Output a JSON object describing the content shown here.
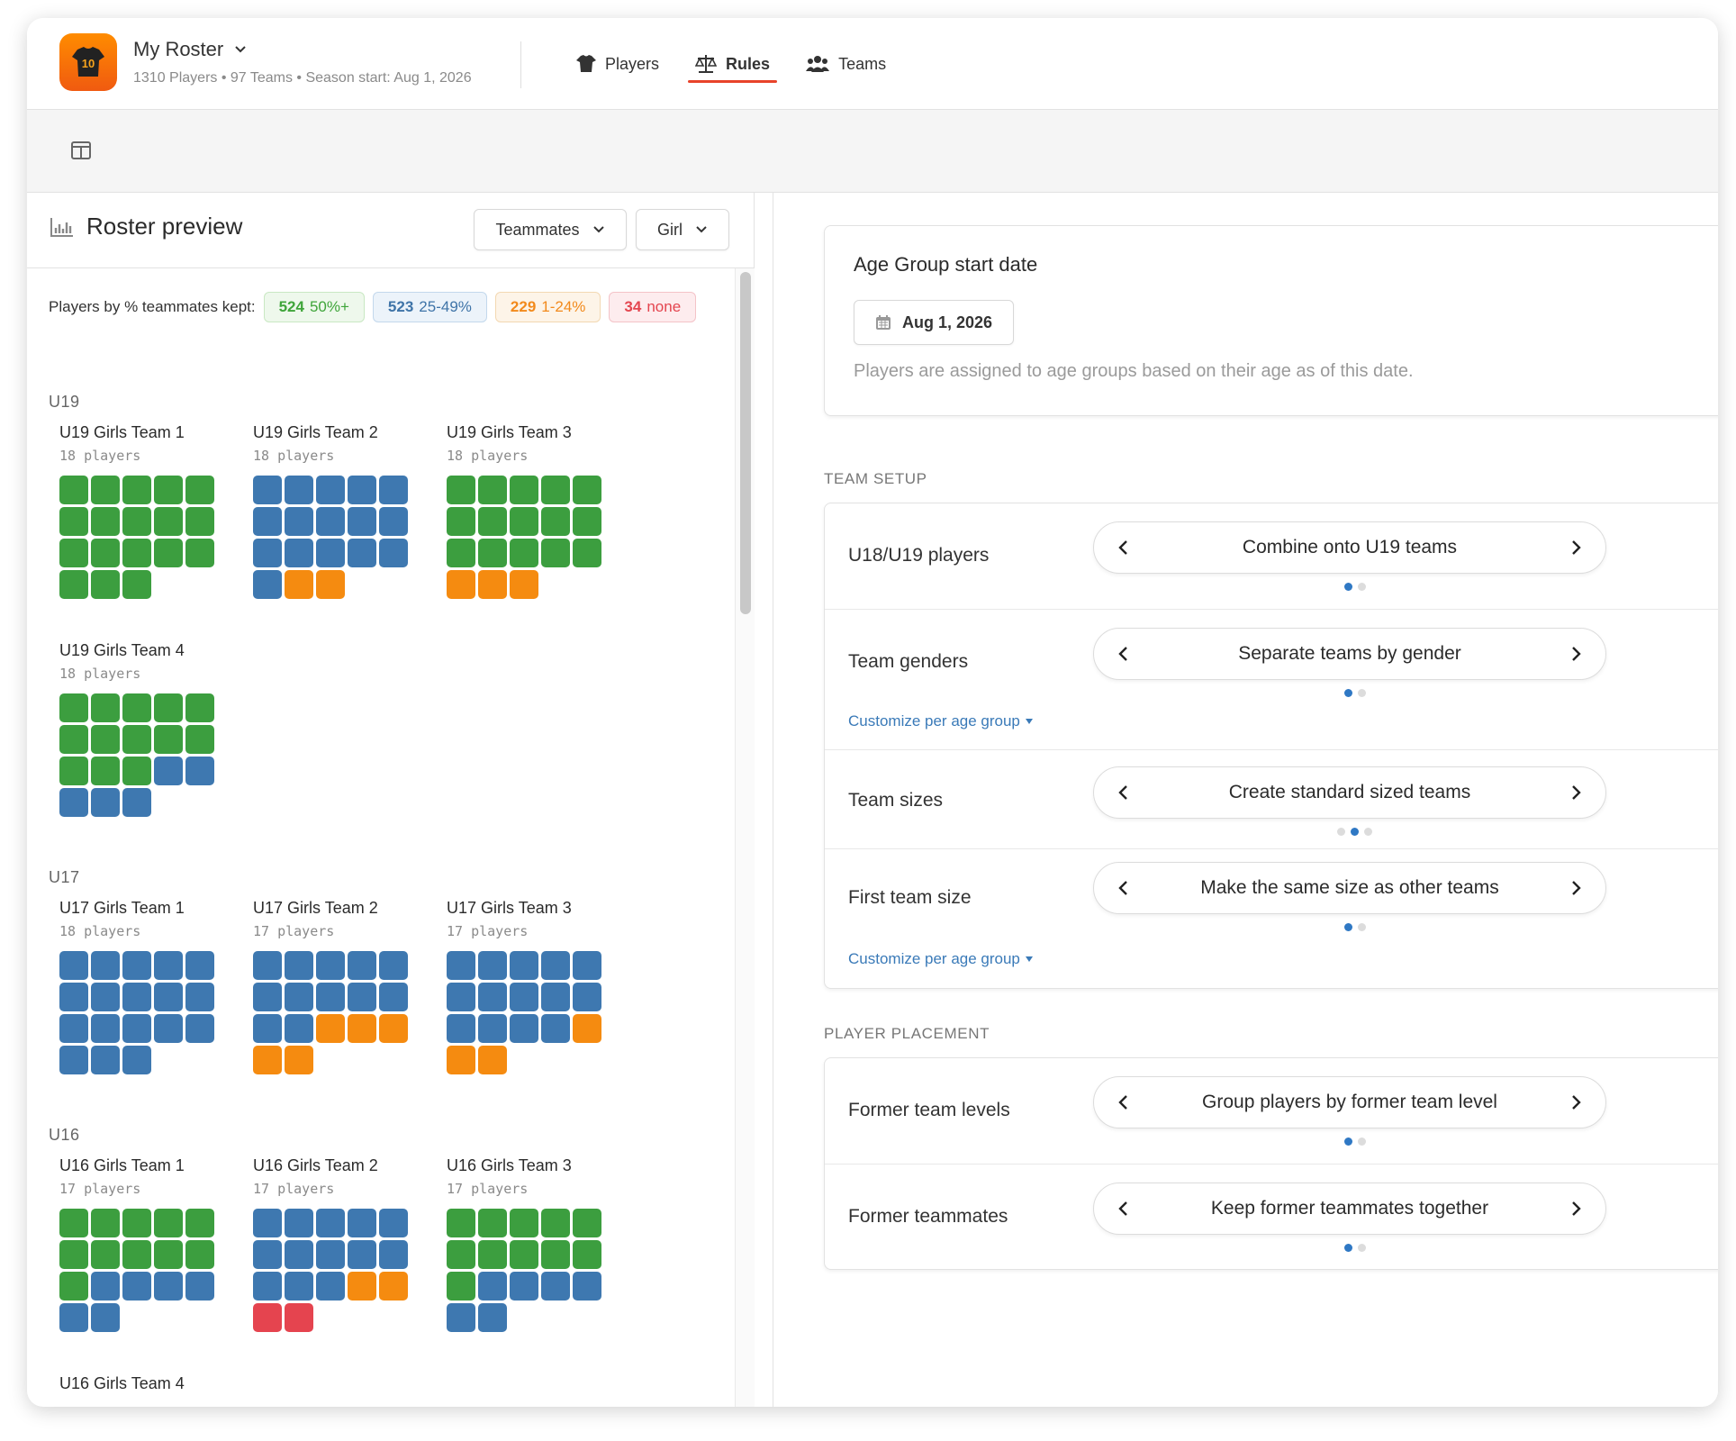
{
  "header": {
    "roster_name": "My Roster",
    "roster_meta": "1310 Players • 97 Teams • Season start: Aug 1, 2026",
    "nav": [
      {
        "label": "Players",
        "icon": "tshirt-icon",
        "active": false
      },
      {
        "label": "Rules",
        "icon": "scale-icon",
        "active": true
      },
      {
        "label": "Teams",
        "icon": "people-icon",
        "active": false
      }
    ]
  },
  "left": {
    "title": "Roster preview",
    "filter_view": "Teammates",
    "filter_gender": "Girl",
    "legend_label": "Players by % teammates kept:",
    "legend": [
      {
        "count": "524",
        "label": "50%+",
        "tone": "green"
      },
      {
        "count": "523",
        "label": "25-49%",
        "tone": "blue"
      },
      {
        "count": "229",
        "label": "1-24%",
        "tone": "orange"
      },
      {
        "count": "34",
        "label": "none",
        "tone": "red"
      }
    ],
    "groups": [
      {
        "label": "U19",
        "teams": [
          {
            "name": "U19 Girls Team 1",
            "count": "18 players",
            "squares": "gggggggggggggggggg"
          },
          {
            "name": "U19 Girls Team 2",
            "count": "18 players",
            "squares": "bbbbbbbbbbbbbbbboo"
          },
          {
            "name": "U19 Girls Team 3",
            "count": "18 players",
            "squares": "gggggggggggggggooo"
          },
          {
            "name": "U19 Girls Team 4",
            "count": "18 players",
            "squares": "gggggggggggggbbbbb"
          }
        ]
      },
      {
        "label": "U17",
        "teams": [
          {
            "name": "U17 Girls Team 1",
            "count": "18 players",
            "squares": "bbbbbbbbbbbbbbbbbb"
          },
          {
            "name": "U17 Girls Team 2",
            "count": "17 players",
            "squares": "bbbbbbbbbbbbooooo"
          },
          {
            "name": "U17 Girls Team 3",
            "count": "17 players",
            "squares": "bbbbbbbbbbbbbbooo"
          }
        ]
      },
      {
        "label": "U16",
        "teams": [
          {
            "name": "U16 Girls Team 1",
            "count": "17 players",
            "squares": "gggggggggggbbbbbb"
          },
          {
            "name": "U16 Girls Team 2",
            "count": "17 players",
            "squares": "bbbbbbbbbbbbboorr"
          },
          {
            "name": "U16 Girls Team 3",
            "count": "17 players",
            "squares": "gggggggggggbbbbbb"
          },
          {
            "name": "U16 Girls Team 4",
            "count": "",
            "squares": ""
          }
        ]
      }
    ]
  },
  "right": {
    "age_card": {
      "title": "Age Group start date",
      "date": "Aug 1, 2026",
      "description": "Players are assigned to age groups based on their age as of this date."
    },
    "team_setup": {
      "label": "TEAM SETUP",
      "rows": [
        {
          "label": "U18/U19 players",
          "value": "Combine onto U19 teams",
          "dots": 2,
          "active_dot": 0,
          "customize": ""
        },
        {
          "label": "Team genders",
          "value": "Separate teams by gender",
          "dots": 2,
          "active_dot": 0,
          "customize": "Customize per age group"
        },
        {
          "label": "Team sizes",
          "value": "Create standard sized teams",
          "dots": 3,
          "active_dot": 1,
          "customize": ""
        },
        {
          "label": "First team size",
          "value": "Make the same size as other teams",
          "dots": 2,
          "active_dot": 0,
          "customize": "Customize per age group"
        }
      ]
    },
    "player_placement": {
      "label": "PLAYER PLACEMENT",
      "rows": [
        {
          "label": "Former team levels",
          "value": "Group players by former team level",
          "dots": 2,
          "active_dot": 0,
          "customize": ""
        },
        {
          "label": "Former teammates",
          "value": "Keep former teammates together",
          "dots": 2,
          "active_dot": 0,
          "customize": ""
        }
      ]
    }
  },
  "colors": {
    "accent": "#e8432a",
    "green": "#3c9e3f",
    "blue": "#3e78b0",
    "orange": "#f58b10",
    "red": "#e5444f",
    "link": "#3a7ab8"
  }
}
